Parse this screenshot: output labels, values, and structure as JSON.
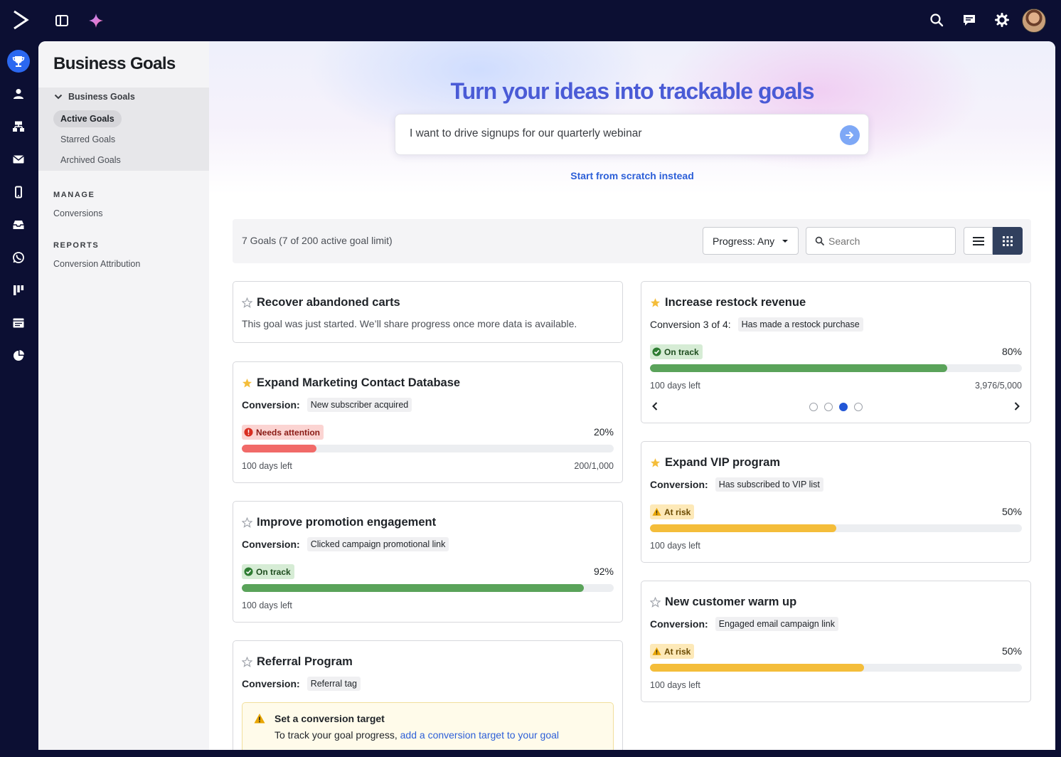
{
  "sidebar": {
    "title": "Business Goals",
    "group_label": "Business Goals",
    "items": [
      {
        "label": "Active Goals"
      },
      {
        "label": "Starred Goals"
      },
      {
        "label": "Archived Goals"
      }
    ],
    "manage_label": "MANAGE",
    "manage_links": [
      {
        "label": "Conversions"
      }
    ],
    "reports_label": "REPORTS",
    "reports_links": [
      {
        "label": "Conversion Attribution"
      }
    ]
  },
  "hero": {
    "title": "Turn your ideas into trackable goals",
    "prompt_value": "I want to drive signups for our quarterly webinar",
    "scratch_link": "Start from scratch instead"
  },
  "filters": {
    "goal_count": "7 Goals (7 of 200 active goal limit)",
    "progress_label": "Progress: Any",
    "search_placeholder": "Search"
  },
  "status_colors": {
    "needs_attention": "#f16a68",
    "on_track": "#5aa35a",
    "at_risk": "#f4bd3a",
    "accent": "#2c5fd8"
  },
  "goals": [
    {
      "title": "Recover abandoned carts",
      "starred": false,
      "message": "This goal was just started. We’ll share progress once more data is available."
    },
    {
      "title": "Expand Marketing Contact Database",
      "starred": true,
      "conversion_label": "Conversion:",
      "conversion": "New subscriber acquired",
      "status": "Needs attention",
      "percent_text": "20%",
      "progress": 0.2,
      "days_left": "100 days left",
      "count": "200/1,000"
    },
    {
      "title": "Improve promotion engagement",
      "starred": false,
      "conversion_label": "Conversion:",
      "conversion": "Clicked campaign promotional link",
      "status": "On track",
      "percent_text": "92%",
      "progress": 0.92,
      "days_left": "100 days left"
    },
    {
      "title": "Referral Program",
      "starred": false,
      "conversion_label": "Conversion:",
      "conversion": "Referral tag",
      "notice_title": "Set a conversion target",
      "notice_text": "To track your goal progress, ",
      "notice_link": "add a conversion target to your goal"
    },
    {
      "title": "Increase restock revenue",
      "starred": true,
      "conversion_label": "Conversion 3 of 4:",
      "conversion": "Has made a restock purchase",
      "status": "On track",
      "percent_text": "80%",
      "progress": 0.8,
      "days_left": "100 days left",
      "count": "3,976/5,000",
      "carousel_page": 3,
      "carousel_total": 4
    },
    {
      "title": "Expand VIP program",
      "starred": true,
      "conversion_label": "Conversion:",
      "conversion": "Has subscribed to VIP list",
      "status": "At risk",
      "percent_text": "50%",
      "progress": 0.5,
      "days_left": "100 days left"
    },
    {
      "title": "New customer warm up",
      "starred": false,
      "conversion_label": "Conversion:",
      "conversion": "Engaged email campaign link",
      "status": "At risk",
      "percent_text": "50%",
      "progress": 0.575,
      "days_left": "100 days left"
    }
  ]
}
